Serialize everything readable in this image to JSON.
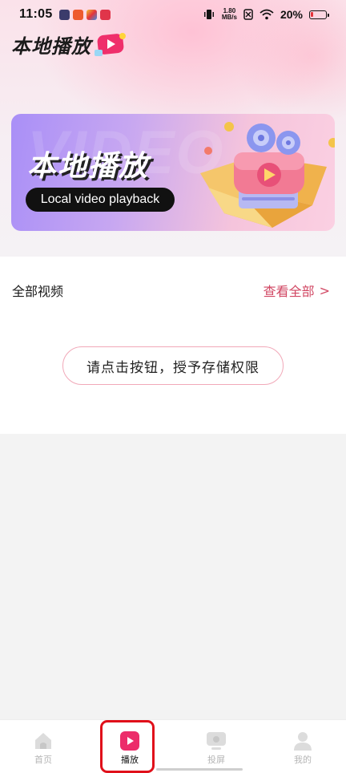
{
  "status_bar": {
    "time": "11:05",
    "net_speed_value": "1.80",
    "net_speed_unit": "MB/s",
    "battery_percent": "20%",
    "battery_level": 0.2
  },
  "page": {
    "title": "本地播放"
  },
  "banner": {
    "title": "本地播放",
    "subtitle": "Local video playback"
  },
  "section": {
    "label": "全部视频",
    "view_all_label": "查看全部",
    "view_all_arrow": ">"
  },
  "permission": {
    "button_label": "请点击按钮，授予存储权限"
  },
  "nav": {
    "items": [
      {
        "label": "首页",
        "icon": "home-icon"
      },
      {
        "label": "播放",
        "icon": "play-icon"
      },
      {
        "label": "投屏",
        "icon": "cast-screen-icon"
      },
      {
        "label": "我的",
        "icon": "user-profile-icon"
      }
    ]
  },
  "colors": {
    "accent": "#d14763",
    "active_highlight": "#e0101a",
    "banner_start": "#a98ff7",
    "banner_end": "#fbd0e2"
  }
}
